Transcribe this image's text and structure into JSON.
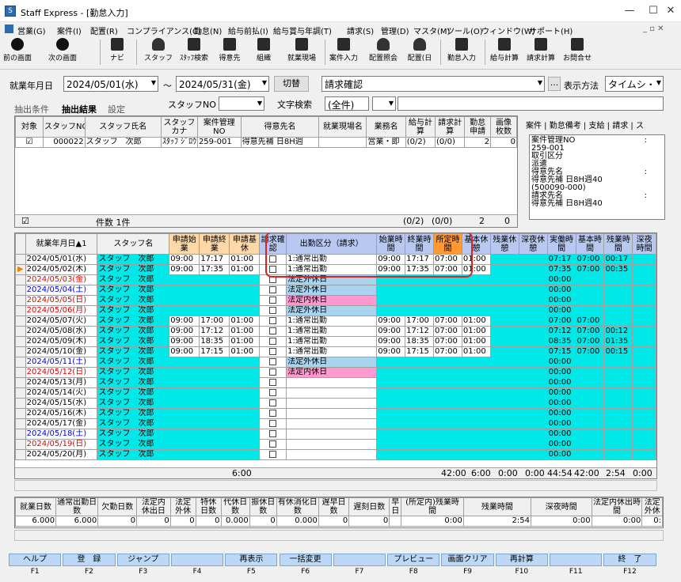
{
  "window": {
    "title": "Staff Express - [勤怠入力]",
    "icon": "app-icon"
  },
  "menu": [
    "営業(G)",
    "案件(I)",
    "配置(R)",
    "コンプライアンス(C)",
    "勤怠(N)",
    "給与前払(I)",
    "給与賞与年調(T)",
    "請求(S)",
    "管理(D)",
    "マスタ(M)",
    "ツール(O)",
    "ウィンドウ(W)",
    "サポート(H)"
  ],
  "toolbar": {
    "prev": "前の画面",
    "next": "次の画面",
    "navi": "ナビ",
    "staff": "スタッフ",
    "staff_search": "ｽﾀｯﾌ検索",
    "client": "得意先",
    "org": "組織",
    "site": "就業現場",
    "case_input": "案件入力",
    "assign_ref": "配置照会",
    "assign_day": "配置(日",
    "attend_input": "勤怠入力",
    "pay_calc": "給与計算",
    "bill_calc": "請求計算",
    "inquiry": "お問合せ"
  },
  "filter": {
    "date_label": "就業年月日",
    "date_from": "2024/05/01(水)",
    "tilde": "～",
    "date_to": "2024/05/31(金)",
    "switch_btn": "切替",
    "bill_confirm": "請求確認",
    "ellipsis": "...",
    "display_label": "表示方法",
    "display_value": "タイムシ・",
    "staff_no_label": "スタッフNO",
    "text_search_label": "文字検索",
    "text_search_value": "(全件)"
  },
  "tabs": {
    "extract_cond": "抽出条件",
    "extract_result": "抽出結果",
    "settings": "設定"
  },
  "upper_grid": {
    "headers": [
      "対象",
      "スタッフNO",
      "スタッフ氏名",
      "スタッフカナ",
      "案件管理NO",
      "得意先名",
      "就業現場名",
      "業務名",
      "給与計算",
      "請求計算",
      "勤怠申請",
      "画像枚数"
    ],
    "row": [
      "☑",
      "000022",
      "スタッフ　次郎",
      "ｽﾀｯﾌ ｼﾞﾛｳ",
      "259-001",
      "得意先補 日8H週",
      "",
      "営業・即",
      "(0/2)",
      "(0/0)",
      "2",
      "0"
    ],
    "footer_count": "件数 1件",
    "footer_vals": [
      "(0/2)",
      "(0/0)",
      "2",
      "0"
    ]
  },
  "case_panel": {
    "tabs": [
      "案件",
      "勤怠備考",
      "支給",
      "請求",
      "ス"
    ],
    "lines": [
      "案件管理NO",
      ":",
      "259-001",
      "取引区分",
      ":",
      "派遣",
      "得意先名",
      ":",
      "得意先補 日8H週40",
      "(500090-000)",
      "請求先名",
      ":",
      "得意先補 日8H週40"
    ]
  },
  "main_grid": {
    "headers": [
      "就業年月日▲1",
      "スタッフ名",
      "申請始業",
      "申請終業",
      "申請基休",
      "請求確認",
      "出勤区分（請求）",
      "始業時間",
      "終業時間",
      "所定時間",
      "基本休憩",
      "残業休憩",
      "深夜休憩",
      "実働時間",
      "基本時間",
      "残業時間",
      "深夜時間"
    ],
    "rows": [
      [
        "2024/05/01(水)",
        "スタッフ　次郎",
        "09:00",
        "17:17",
        "01:00",
        "1:通常出勤",
        "09:00",
        "17:17",
        "07:00",
        "01:00",
        "",
        "",
        "07:17",
        "07:00",
        "00:17",
        ""
      ],
      [
        "2024/05/02(木)",
        "スタッフ　次郎",
        "09:00",
        "17:35",
        "01:00",
        "1:通常出勤",
        "09:00",
        "17:35",
        "07:00",
        "01:00",
        "",
        "",
        "07:35",
        "07:00",
        "00:35",
        ""
      ],
      [
        "2024/05/03(金)",
        "スタッフ　次郎",
        "",
        "",
        "",
        "法定外休日",
        "",
        "",
        "",
        "",
        "",
        "",
        "00:00",
        "",
        "",
        ""
      ],
      [
        "2024/05/04(土)",
        "スタッフ　次郎",
        "",
        "",
        "",
        "法定外休日",
        "",
        "",
        "",
        "",
        "",
        "",
        "00:00",
        "",
        "",
        ""
      ],
      [
        "2024/05/05(日)",
        "スタッフ　次郎",
        "",
        "",
        "",
        "法定内休日",
        "",
        "",
        "",
        "",
        "",
        "",
        "00:00",
        "",
        "",
        ""
      ],
      [
        "2024/05/06(月)",
        "スタッフ　次郎",
        "",
        "",
        "",
        "法定外休日",
        "",
        "",
        "",
        "",
        "",
        "",
        "00:00",
        "",
        "",
        ""
      ],
      [
        "2024/05/07(火)",
        "スタッフ　次郎",
        "09:00",
        "17:00",
        "01:00",
        "1:通常出勤",
        "09:00",
        "17:00",
        "07:00",
        "01:00",
        "",
        "",
        "07:00",
        "07:00",
        "",
        ""
      ],
      [
        "2024/05/08(水)",
        "スタッフ　次郎",
        "09:00",
        "17:12",
        "01:00",
        "1:通常出勤",
        "09:00",
        "17:12",
        "07:00",
        "01:00",
        "",
        "",
        "07:12",
        "07:00",
        "00:12",
        ""
      ],
      [
        "2024/05/09(木)",
        "スタッフ　次郎",
        "09:00",
        "18:35",
        "01:00",
        "1:通常出勤",
        "09:00",
        "18:35",
        "07:00",
        "01:00",
        "",
        "",
        "08:35",
        "07:00",
        "01:35",
        ""
      ],
      [
        "2024/05/10(金)",
        "スタッフ　次郎",
        "09:00",
        "17:15",
        "01:00",
        "1:通常出勤",
        "09:00",
        "17:15",
        "07:00",
        "01:00",
        "",
        "",
        "07:15",
        "07:00",
        "00:15",
        ""
      ],
      [
        "2024/05/11(土)",
        "スタッフ　次郎",
        "",
        "",
        "",
        "法定外休日",
        "",
        "",
        "",
        "",
        "",
        "",
        "00:00",
        "",
        "",
        ""
      ],
      [
        "2024/05/12(日)",
        "スタッフ　次郎",
        "",
        "",
        "",
        "法定内休日",
        "",
        "",
        "",
        "",
        "",
        "",
        "00:00",
        "",
        "",
        ""
      ],
      [
        "2024/05/13(月)",
        "スタッフ　次郎",
        "",
        "",
        "",
        "",
        "",
        "",
        "",
        "",
        "",
        "",
        "00:00",
        "",
        "",
        ""
      ],
      [
        "2024/05/14(火)",
        "スタッフ　次郎",
        "",
        "",
        "",
        "",
        "",
        "",
        "",
        "",
        "",
        "",
        "00:00",
        "",
        "",
        ""
      ],
      [
        "2024/05/15(水)",
        "スタッフ　次郎",
        "",
        "",
        "",
        "",
        "",
        "",
        "",
        "",
        "",
        "",
        "00:00",
        "",
        "",
        ""
      ],
      [
        "2024/05/16(木)",
        "スタッフ　次郎",
        "",
        "",
        "",
        "",
        "",
        "",
        "",
        "",
        "",
        "",
        "00:00",
        "",
        "",
        ""
      ],
      [
        "2024/05/17(金)",
        "スタッフ　次郎",
        "",
        "",
        "",
        "",
        "",
        "",
        "",
        "",
        "",
        "",
        "00:00",
        "",
        "",
        ""
      ],
      [
        "2024/05/18(土)",
        "スタッフ　次郎",
        "",
        "",
        "",
        "",
        "",
        "",
        "",
        "",
        "",
        "",
        "00:00",
        "",
        "",
        ""
      ],
      [
        "2024/05/19(日)",
        "スタッフ　次郎",
        "",
        "",
        "",
        "",
        "",
        "",
        "",
        "",
        "",
        "",
        "00:00",
        "",
        "",
        ""
      ],
      [
        "2024/05/20(月)",
        "スタッフ　次郎",
        "",
        "",
        "",
        "",
        "",
        "",
        "",
        "",
        "",
        "",
        "00:00",
        "",
        "",
        ""
      ]
    ],
    "totals": [
      "6:00",
      "42:00",
      "6:00",
      "0:00",
      "0:00",
      "44:54",
      "42:00",
      "2:54",
      "0:00"
    ]
  },
  "summary": {
    "headers": [
      "就業日数",
      "通常出勤日数",
      "欠勤日数",
      "法定内休出日",
      "法定外休",
      "特休日数",
      "代休日数",
      "振休日数",
      "有休消化日数",
      "遅早日数",
      "遅刻日数",
      "早日",
      "(所定内)残業時間",
      "残業時間",
      "深夜時間",
      "法定内休出時間",
      "法定外休"
    ],
    "values": [
      "6.000",
      "6.000",
      "0",
      "0",
      "0",
      "0",
      "0.000",
      "0",
      "0.000",
      "0",
      "0",
      "",
      "0:00",
      "2:54",
      "0:00",
      "0:00",
      "0:"
    ]
  },
  "fkeys": [
    [
      "ヘルプ",
      "F1"
    ],
    [
      "登　録",
      "F2"
    ],
    [
      "ジャンプ",
      "F3"
    ],
    [
      "",
      "F4"
    ],
    [
      "再表示",
      "F5"
    ],
    [
      "一括変更",
      "F6"
    ],
    [
      "",
      "F7"
    ],
    [
      "プレビュー",
      "F8"
    ],
    [
      "画面クリア",
      "F9"
    ],
    [
      "再計算",
      "F10"
    ],
    [
      "",
      "F11"
    ],
    [
      "終　了",
      "F12"
    ]
  ]
}
